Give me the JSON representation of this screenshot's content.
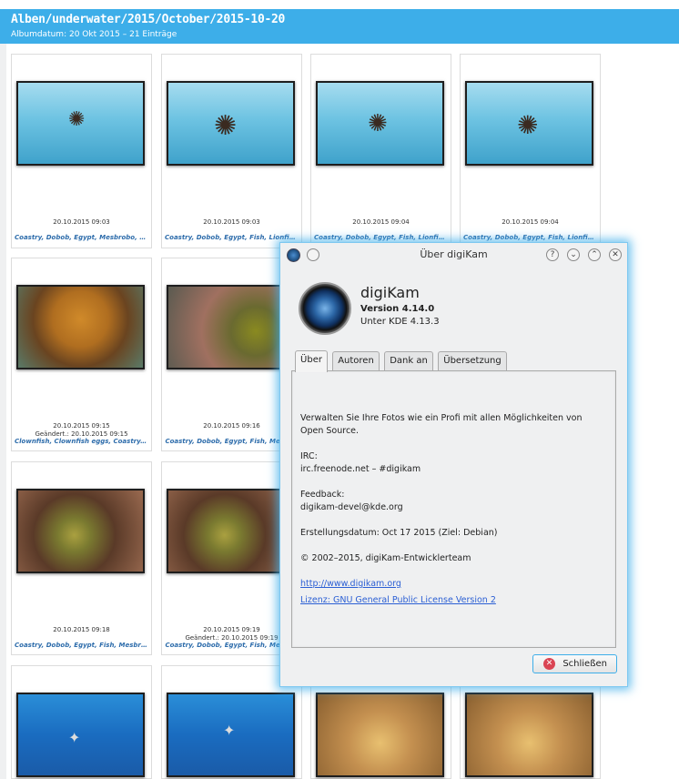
{
  "header": {
    "path": "Alben/underwater/2015/October/2015-10-20",
    "subtitle": "Albumdatum: 20 Okt 2015 – 21 Einträge"
  },
  "thumbnails": [
    {
      "date": "20.10.2015 09:03",
      "tags": "Coastry, Dobob, Egypt, Mesbrobo, Ocrr..."
    },
    {
      "date": "20.10.2015 09:03",
      "tags": "Coastry, Dobob, Egypt, Fish, Lionfish, M..."
    },
    {
      "date": "20.10.2015 09:04",
      "tags": "Coastry, Dobob, Egypt, Fish, Lionfish, M..."
    },
    {
      "date": "20.10.2015 09:04",
      "tags": "Coastry, Dobob, Egypt, Fish, Lionfish, M..."
    },
    {
      "date": "20.10.2015 09:15",
      "changed": "Geändert.: 20.10.2015 09:15",
      "tags": "Clownfish, Clownfish eggs, Coastry, Do..."
    },
    {
      "date": "20.10.2015 09:16",
      "tags": "Coastry, Dobob, Egypt, Fish, Mesbrol"
    },
    {
      "date": "20.10.2015 09:18",
      "tags": "Coastry, Dobob, Egypt, Fish, Mesbrobo, ..."
    },
    {
      "date": "20.10.2015 09:19",
      "changed": "Geändert.: 20.10.2015 09:19",
      "tags": "Coastry, Dobob, Egypt, Fish, Mesbrol"
    }
  ],
  "dialog": {
    "title": "Über digiKam",
    "app_name": "digiKam",
    "version": "Version 4.14.0",
    "kde": "Unter KDE 4.13.3",
    "tabs": [
      "Über",
      "Autoren",
      "Dank an",
      "Übersetzung"
    ],
    "description": "Verwalten Sie Ihre Fotos wie ein Profi mit allen Möglichkeiten von",
    "description2": "Open Source.",
    "irc_label": "IRC:",
    "irc_value": "irc.freenode.net – #digikam",
    "feedback_label": "Feedback:",
    "feedback_value": "digikam-devel@kde.org",
    "build_date": "Erstellungsdatum: Oct 17 2015 (Ziel: Debian)",
    "copyright": "© 2002–2015, digiKam-Entwicklerteam",
    "website": "http://www.digikam.org",
    "license": "Lizenz: GNU General Public License Version 2",
    "close_label": "Schließen",
    "buttons": {
      "help": "?",
      "min": "⌄",
      "max": "⌃",
      "close": "✕"
    }
  }
}
